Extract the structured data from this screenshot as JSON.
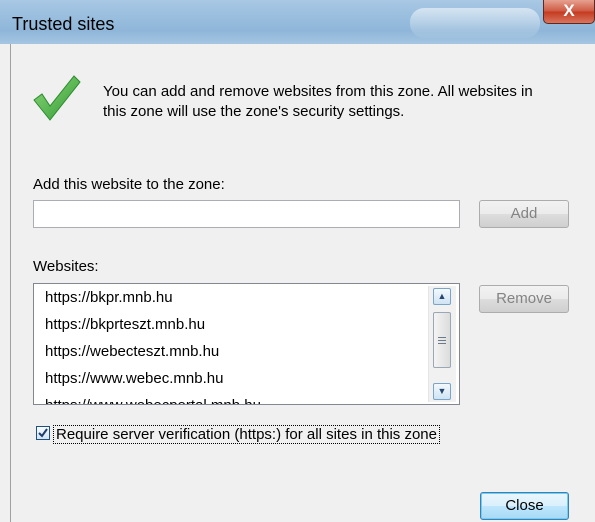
{
  "window": {
    "title": "Trusted sites",
    "close_glyph": "X"
  },
  "info": {
    "line1": "You can add and remove websites from this zone. All websites in",
    "line2": "this zone will use the zone's security settings."
  },
  "add": {
    "label": "Add this website to the zone:",
    "value": "",
    "button": "Add"
  },
  "websites": {
    "label": "Websites:",
    "items": [
      "https://bkpr.mnb.hu",
      "https://bkprteszt.mnb.hu",
      "https://webecteszt.mnb.hu",
      "https://www.webec.mnb.hu",
      "https://www.webecportal.mnb.hu"
    ],
    "remove_button": "Remove"
  },
  "verification": {
    "label": "Require server verification (https:) for all sites in this zone",
    "checked": true
  },
  "footer": {
    "close_button": "Close"
  },
  "icons": {
    "check": "checkmark-icon",
    "scroll_up": "chevron-up-icon",
    "scroll_down": "chevron-down-icon"
  },
  "colors": {
    "accent_green": "#3ea83a",
    "titlebar": "#9cc0df",
    "close_red": "#c43a20"
  }
}
